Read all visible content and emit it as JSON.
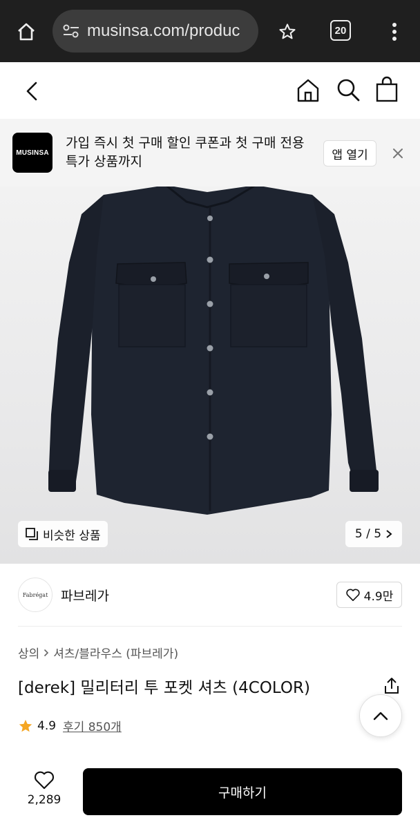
{
  "browser": {
    "url": "musinsa.com/produc",
    "tab_count": "20"
  },
  "promo": {
    "logo_text": "MUSINSA",
    "message": "가입 즉시 첫 구매 할인 쿠폰과 첫 구매 전용 특가 상품까지",
    "open_app_label": "앱 열기"
  },
  "gallery": {
    "similar_label": "비슷한 상품",
    "pager": "5 / 5"
  },
  "brand": {
    "logo_text": "Fabrégat",
    "name": "파브레가",
    "likes": "4.9만"
  },
  "breadcrumb": {
    "items": [
      "상의",
      "셔츠/블라우스 (파브레가)"
    ]
  },
  "product": {
    "title": "[derek] 밀리터리 투 포켓 셔츠 (4COLOR)",
    "rating": "4.9",
    "reviews": "후기 850개"
  },
  "bottom": {
    "wish_count": "2,289",
    "buy_label": "구매하기"
  },
  "colors": {
    "shirt": "#1e2430",
    "accent_star": "#f5a623",
    "buy_button": "#000000"
  }
}
